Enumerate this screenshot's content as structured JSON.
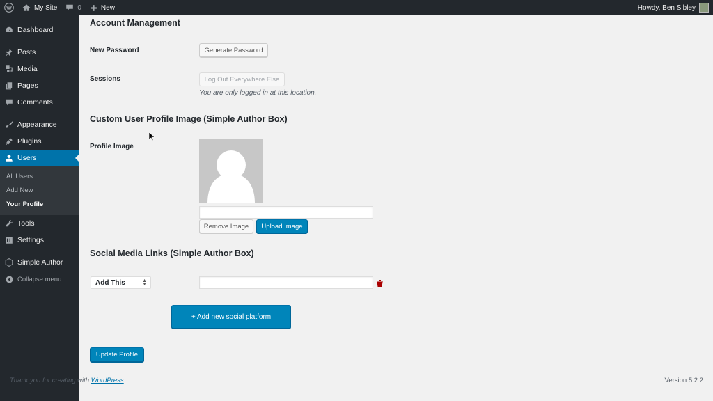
{
  "adminbar": {
    "wp_logo": "wordpress-logo-icon",
    "site_name": "My Site",
    "comments_count": "0",
    "new_label": "New",
    "greeting": "Howdy, Ben Sibley"
  },
  "sidebar": {
    "items": [
      {
        "label": "Dashboard",
        "icon": "dashboard-icon"
      },
      {
        "label": "Posts",
        "icon": "pin-icon"
      },
      {
        "label": "Media",
        "icon": "media-icon"
      },
      {
        "label": "Pages",
        "icon": "pages-icon"
      },
      {
        "label": "Comments",
        "icon": "comment-icon"
      },
      {
        "label": "Appearance",
        "icon": "brush-icon"
      },
      {
        "label": "Plugins",
        "icon": "plug-icon"
      },
      {
        "label": "Users",
        "icon": "user-icon",
        "active": true
      },
      {
        "label": "Tools",
        "icon": "wrench-icon"
      },
      {
        "label": "Settings",
        "icon": "settings-icon"
      },
      {
        "label": "Simple Author",
        "icon": "hexagon-icon"
      },
      {
        "label": "Collapse menu",
        "icon": "collapse-icon"
      }
    ],
    "users_submenu": [
      {
        "label": "All Users"
      },
      {
        "label": "Add New"
      },
      {
        "label": "Your Profile",
        "current": true
      }
    ]
  },
  "main": {
    "account_heading": "Account Management",
    "new_password_label": "New Password",
    "generate_password_button": "Generate Password",
    "sessions_label": "Sessions",
    "logout_everywhere_button": "Log Out Everywhere Else",
    "sessions_description": "You are only logged in at this location.",
    "profile_image_heading": "Custom User Profile Image (Simple Author Box)",
    "profile_image_label": "Profile Image",
    "profile_image_url": "",
    "remove_image_button": "Remove Image",
    "upload_image_button": "Upload Image",
    "social_heading": "Social Media Links (Simple Author Box)",
    "social_select_value": "Add This",
    "social_url_value": "",
    "add_social_button": "+ Add new social platform",
    "update_profile_button": "Update Profile"
  },
  "footer": {
    "thanks_prefix": "Thank you for creating with ",
    "wordpress_link": "WordPress",
    "thanks_suffix": ".",
    "version": "Version 5.2.2"
  },
  "colors": {
    "accent": "#0073aa",
    "primary_button": "#0085ba",
    "sidebar_bg": "#23282d",
    "delete_icon": "#a00"
  }
}
